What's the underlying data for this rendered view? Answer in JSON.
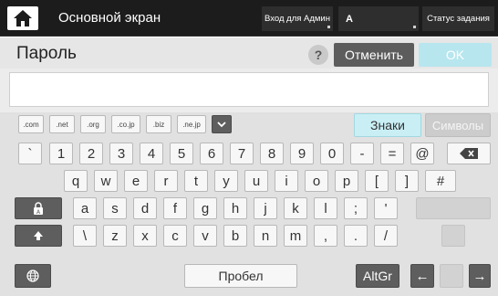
{
  "topbar": {
    "title": "Основной экран",
    "admin_login": "Вход для Админ",
    "user_indicator": "A",
    "job_status": "Статус задания",
    "home_icon": "home-icon"
  },
  "dialog": {
    "title": "Пароль",
    "help_label": "?",
    "cancel_label": "Отменить",
    "ok_label": "OK",
    "input_value": ""
  },
  "keyboard": {
    "domain_keys": [
      ".com",
      ".net",
      ".org",
      ".co.jp",
      ".biz",
      ".ne.jp"
    ],
    "znaki_label": "Знаки",
    "simvoly_label": "Символы",
    "row1": [
      "`",
      "1",
      "2",
      "3",
      "4",
      "5",
      "6",
      "7",
      "8",
      "9",
      "0",
      "-",
      "=",
      "@"
    ],
    "row2": [
      "q",
      "w",
      "e",
      "r",
      "t",
      "y",
      "u",
      "i",
      "o",
      "p",
      "[",
      "]",
      "#"
    ],
    "row3": [
      "a",
      "s",
      "d",
      "f",
      "g",
      "h",
      "j",
      "k",
      "l",
      ";",
      "'"
    ],
    "row4": [
      "\\",
      "z",
      "x",
      "c",
      "v",
      "b",
      "n",
      "m",
      ",",
      ".",
      "/"
    ],
    "space_label": "Пробел",
    "altgr_label": "AltGr",
    "left_arrow": "←",
    "right_arrow": "→",
    "icons": {
      "dropdown": "chevron-down-icon",
      "backspace": "backspace-icon",
      "caps_lock": "lock-icon",
      "shift": "shift-arrow-icon",
      "language": "globe-icon"
    },
    "colors": {
      "accent_teal": "#c9eff5",
      "dark_key": "#5e5e5e",
      "topbar": "#1c1c1c"
    }
  }
}
